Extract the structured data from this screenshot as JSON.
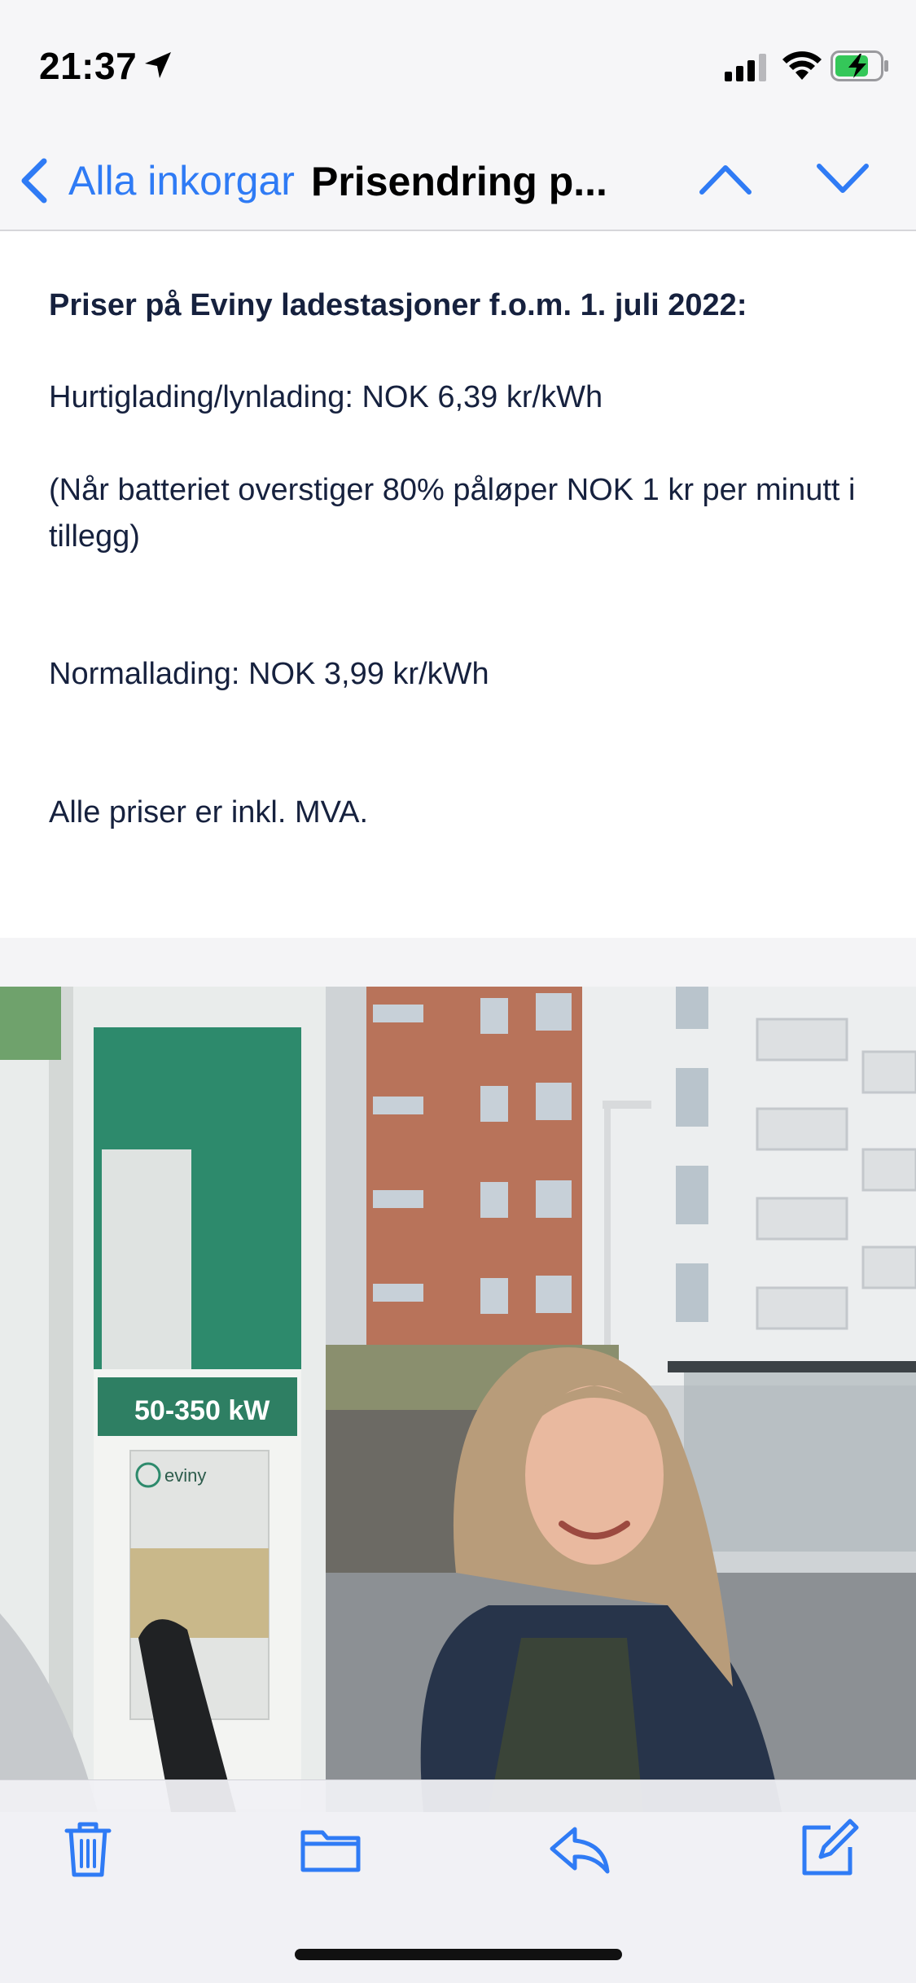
{
  "status_bar": {
    "time": "21:37",
    "icons": [
      "location-arrow-icon",
      "cellular-signal-icon",
      "wifi-icon",
      "battery-charging-icon"
    ]
  },
  "nav": {
    "back_label": "Alla inkorgar",
    "title": "Prisendring p...",
    "back_icon": "chevron-left-icon",
    "prev_icon": "chevron-up-icon",
    "next_icon": "chevron-down-icon",
    "accent_color": "#2f7bf5"
  },
  "email": {
    "heading": "Priser på Eviny ladestasjoner f.o.m. 1. juli 2022:",
    "fast_charging": "Hurtiglading/lynlading: NOK 6,39 kr/kWh",
    "battery_surcharge": "(Når batteriet overstiger 80% påløper NOK 1 kr per minutt i tillegg)",
    "normal_charging": "Normallading: NOK 3,99 kr/kWh",
    "vat_note": "Alle priser er inkl. MVA.",
    "text_color": "#16213e"
  },
  "photo": {
    "charger_power_label": "50-350 kW",
    "brand_label": "eviny"
  },
  "toolbar": {
    "icons": [
      "trash-icon",
      "folder-icon",
      "reply-icon",
      "compose-icon"
    ]
  }
}
